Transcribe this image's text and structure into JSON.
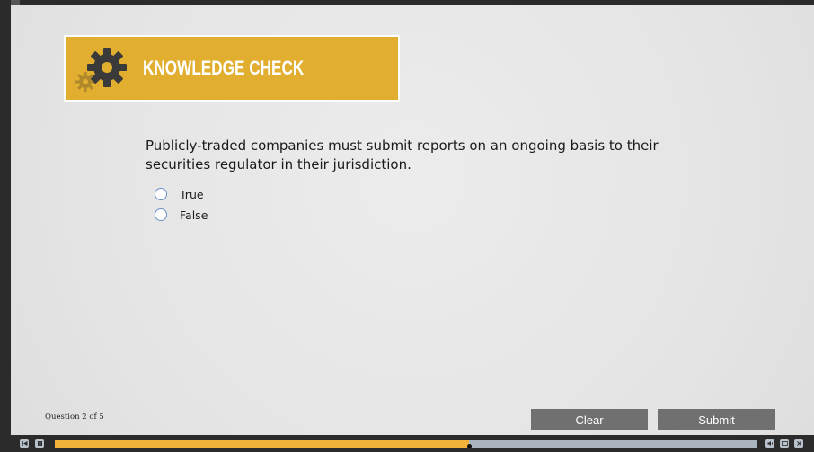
{
  "banner": {
    "title": "KNOWLEDGE CHECK",
    "icon": "gear-icon",
    "color": "#e2ae2f"
  },
  "question": {
    "text": "Publicly-traded companies must submit reports on an ongoing basis to their securities regulator in their jurisdiction.",
    "options": [
      {
        "label": "True",
        "selected": false
      },
      {
        "label": "False",
        "selected": false
      }
    ]
  },
  "footer": {
    "counter": "Question 2 of 5",
    "clear_label": "Clear",
    "submit_label": "Submit"
  },
  "player": {
    "progress": 0.59,
    "controls_left": [
      "rewind-icon",
      "play-pause-icon"
    ],
    "controls_right": [
      "volume-icon",
      "captions-icon",
      "close-icon"
    ]
  }
}
